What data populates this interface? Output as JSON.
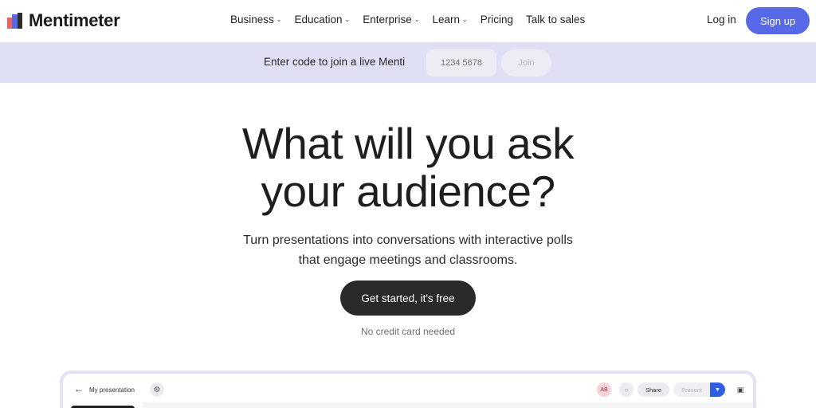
{
  "brand": {
    "name": "Mentimeter",
    "logo_colors": [
      "#f0605d",
      "#5769e7",
      "#2c2c2c"
    ]
  },
  "nav": {
    "items": [
      {
        "label": "Business",
        "has_dropdown": true
      },
      {
        "label": "Education",
        "has_dropdown": true
      },
      {
        "label": "Enterprise",
        "has_dropdown": true
      },
      {
        "label": "Learn",
        "has_dropdown": true
      },
      {
        "label": "Pricing",
        "has_dropdown": false
      },
      {
        "label": "Talk to sales",
        "has_dropdown": false
      }
    ],
    "login": "Log in",
    "signup": "Sign up",
    "accent": "#5769e7"
  },
  "joinbar": {
    "label": "Enter code to join a live Menti",
    "code_placeholder": "1234 5678",
    "join_button": "Join"
  },
  "hero": {
    "title_line1": "What will you ask",
    "title_line2": "your audience?",
    "subtitle_line1": "Turn presentations into conversations with interactive polls",
    "subtitle_line2": "that engage meetings and classrooms.",
    "cta": "Get started, it's free",
    "note": "No credit card needed"
  },
  "preview": {
    "presentation_title": "My presentation",
    "avatar_initials": "AB",
    "share": "Share",
    "present": "Present"
  }
}
